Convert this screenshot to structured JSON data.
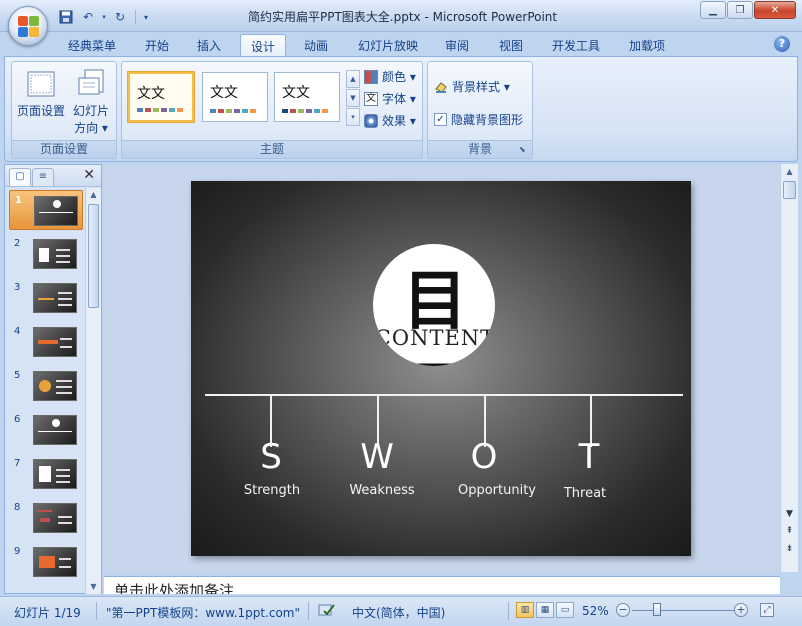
{
  "window": {
    "title": "简约实用扁平PPT图表大全.pptx - Microsoft PowerPoint"
  },
  "ribbon": {
    "tabs": [
      {
        "label": "经典菜单"
      },
      {
        "label": "开始"
      },
      {
        "label": "插入"
      },
      {
        "label": "设计"
      },
      {
        "label": "动画"
      },
      {
        "label": "幻灯片放映"
      },
      {
        "label": "审阅"
      },
      {
        "label": "视图"
      },
      {
        "label": "开发工具"
      },
      {
        "label": "加载项"
      }
    ],
    "page_setup_group": {
      "label": "页面设置",
      "page_setup_button": "页面设置",
      "orientation_button_line1": "幻灯片",
      "orientation_button_line2": "方向 ▾"
    },
    "themes_group": {
      "label": "主题",
      "theme_thumb_text": "文文",
      "colors": "颜色 ▾",
      "fonts": "字体 ▾",
      "effects": "效果 ▾"
    },
    "background_group": {
      "label": "背景",
      "background_styles": "背景样式 ▾",
      "hide_background_graphics": "隐藏背景图形",
      "hide_background_graphics_checked": "✓"
    }
  },
  "thumbnails": {
    "items": [
      {
        "num": "1"
      },
      {
        "num": "2"
      },
      {
        "num": "3"
      },
      {
        "num": "4"
      },
      {
        "num": "5"
      },
      {
        "num": "6"
      },
      {
        "num": "7"
      },
      {
        "num": "8"
      },
      {
        "num": "9"
      }
    ]
  },
  "slide": {
    "circle_title": "目录",
    "circle_subtitle": "CONTENT",
    "swot": [
      {
        "letter": "S",
        "word": "Strength"
      },
      {
        "letter": "W",
        "word": "Weakness"
      },
      {
        "letter": "O",
        "word": "Opportunity"
      },
      {
        "letter": "T",
        "word": "Threat"
      }
    ]
  },
  "notes": {
    "placeholder": "单击此处添加备注"
  },
  "status": {
    "slide_info": "幻灯片 1/19",
    "theme_name": "\"第一PPT模板网：www.1ppt.com\"",
    "language": "中文(简体，中国)",
    "zoom": "52%"
  },
  "colors": {
    "ribbon_accent": "#15428b",
    "selected_thumb": "#e8953a"
  }
}
